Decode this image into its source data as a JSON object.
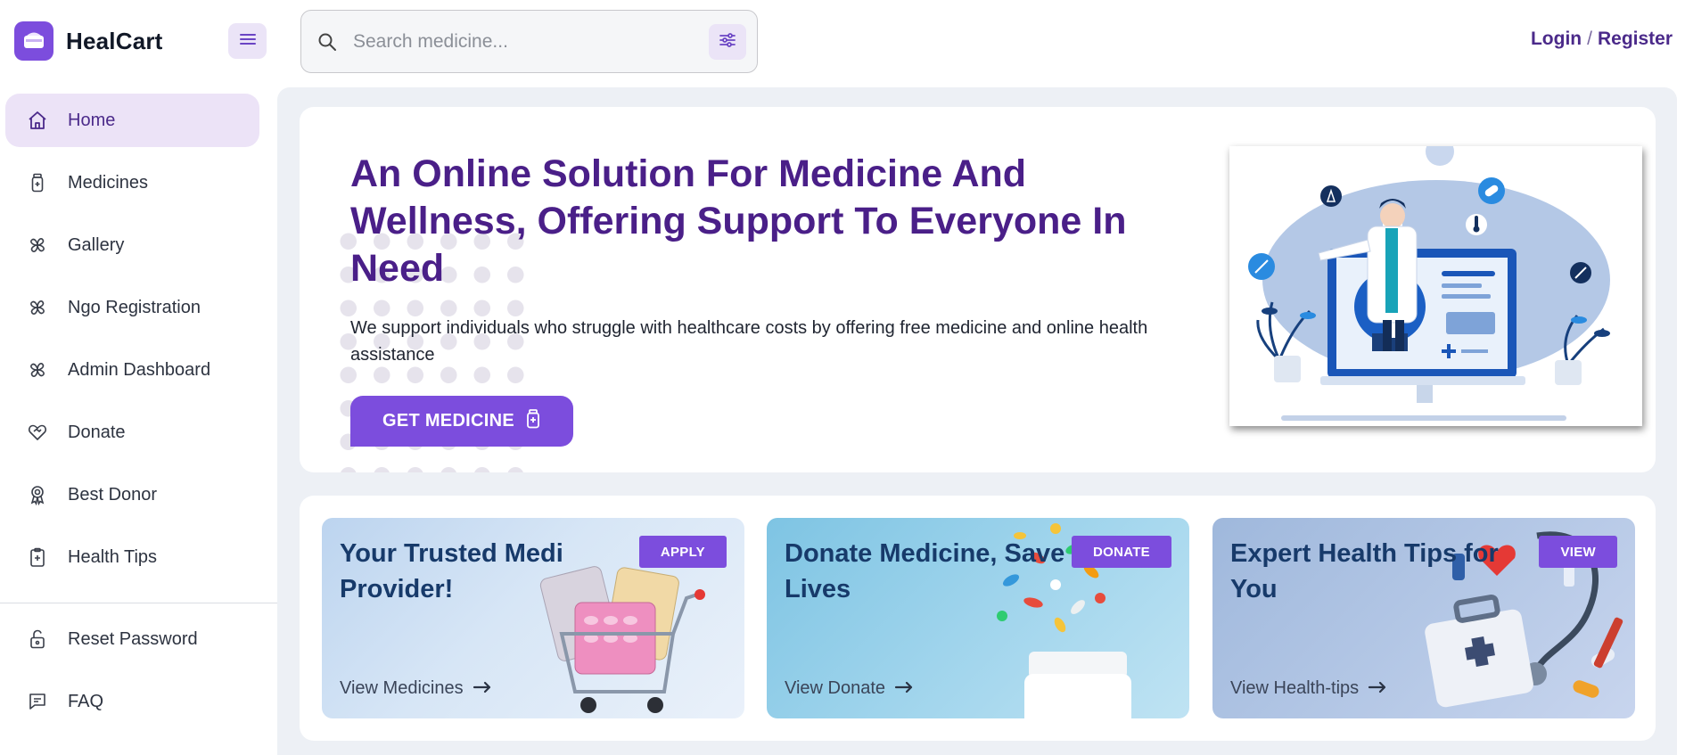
{
  "app": {
    "name": "HealCart"
  },
  "search": {
    "placeholder": "Search medicine..."
  },
  "auth": {
    "login_label": "Login",
    "separator": "/",
    "register_label": "Register"
  },
  "sidebar": {
    "items": [
      {
        "label": "Home",
        "icon": "home-icon",
        "active": true
      },
      {
        "label": "Medicines",
        "icon": "medicine-bottle-icon"
      },
      {
        "label": "Gallery",
        "icon": "pinwheel-icon"
      },
      {
        "label": "Ngo Registration",
        "icon": "pinwheel-icon"
      },
      {
        "label": "Admin Dashboard",
        "icon": "pinwheel-icon"
      },
      {
        "label": "Donate",
        "icon": "heart-handshake-icon"
      },
      {
        "label": "Best Donor",
        "icon": "award-icon"
      },
      {
        "label": "Health Tips",
        "icon": "clipboard-icon"
      }
    ],
    "bottom_items": [
      {
        "label": "Reset Password",
        "icon": "unlock-icon"
      },
      {
        "label": "FAQ",
        "icon": "chat-icon"
      }
    ]
  },
  "hero": {
    "title": "An Online Solution For Medicine And Wellness, Offering Support To Everyone In Need",
    "subtitle": "We support individuals who struggle with healthcare costs by offering free medicine and online health assistance",
    "button_label": "GET MEDICINE"
  },
  "cards": [
    {
      "title": "Your Trusted Medi Provider!",
      "badge": "APPLY",
      "link": "View Medicines"
    },
    {
      "title": "Donate Medicine, Save Lives",
      "badge": "DONATE",
      "link": "View Donate"
    },
    {
      "title": "Expert Health Tips for You",
      "badge": "VIEW",
      "link": "View Health-tips"
    }
  ],
  "colors": {
    "accent": "#7c4ddd",
    "heading": "#4a1f88",
    "active_nav_bg": "#ece3f7",
    "main_bg": "#edf0f5"
  }
}
